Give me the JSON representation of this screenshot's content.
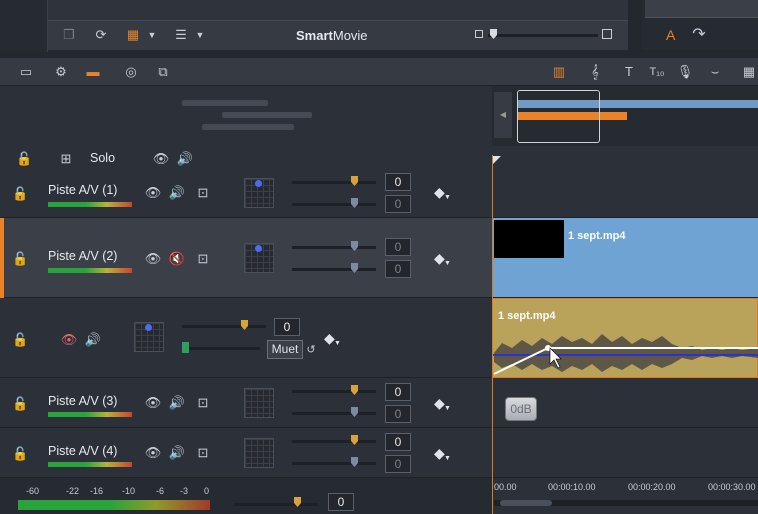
{
  "app": {
    "title_bold": "Smart",
    "title_rest": "Movie"
  },
  "topbar": {
    "text_icon": "A"
  },
  "header": {
    "solo_label": "Solo"
  },
  "tracks": [
    {
      "name": "Piste A/V (1)",
      "vol": "0",
      "pan": "0"
    },
    {
      "name": "Piste A/V (2)",
      "vol": "0",
      "pan": "0"
    },
    {
      "name": "",
      "vol": "0",
      "mute_label": "Muet"
    },
    {
      "name": "Piste A/V (3)",
      "vol": "0",
      "pan": "0"
    },
    {
      "name": "Piste A/V (4)",
      "vol": "0",
      "pan": "0"
    }
  ],
  "clips": {
    "video_clip": "1 sept.mp4",
    "audio_clip": "1 sept.mp4",
    "db_badge": "0dB"
  },
  "ruler": {
    "t0": "00.00",
    "t1": "00:00:10.00",
    "t2": "00:00:20.00",
    "t3": "00:00:30.00"
  },
  "master": {
    "scale": [
      "-60",
      "-22",
      "-16",
      "-10",
      "-6",
      "-3",
      "0"
    ],
    "vol": "0"
  },
  "colors": {
    "accent": "#e8832a",
    "video_clip": "#6fa3d4",
    "audio_clip": "#b9a25a",
    "selected_track": "#3a3f48"
  }
}
